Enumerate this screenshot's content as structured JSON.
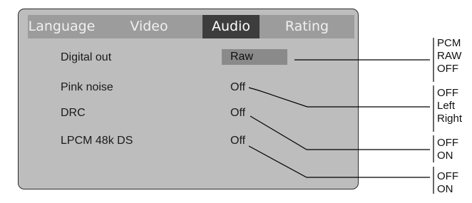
{
  "tabs": [
    "Language",
    "Video",
    "Audio",
    "Rating"
  ],
  "active_tab": "Audio",
  "settings": [
    {
      "label": "Digital out",
      "value": "Raw"
    },
    {
      "label": "Pink noise",
      "value": "Off"
    },
    {
      "label": "DRC",
      "value": "Off"
    },
    {
      "label": "LPCM 48k DS",
      "value": "Off"
    }
  ],
  "options": {
    "digital_out": [
      "PCM",
      "RAW",
      "OFF"
    ],
    "pink_noise": [
      "OFF",
      "Left",
      "Right"
    ],
    "drc": [
      "OFF",
      "ON"
    ],
    "lpcm": [
      "OFF",
      "ON"
    ]
  },
  "colors": {
    "panel": "#bdbdbd",
    "tabbar": "#9c9c9c",
    "active_tab": "#3d3d3d",
    "selected_value": "#8a8a8a"
  }
}
